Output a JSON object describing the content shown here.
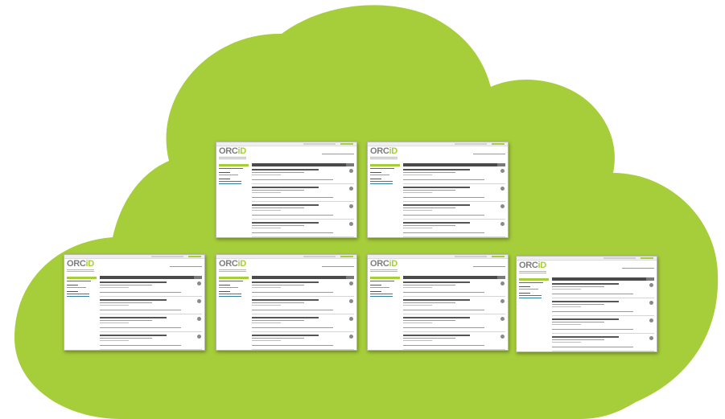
{
  "background": {
    "cloud_color": "#a6cd3a",
    "page_color": "#ffffff"
  },
  "cards": [
    {
      "logo_main": "ORC",
      "logo_accent": "iD",
      "nav": [
        "",
        "",
        "",
        ""
      ],
      "name": ""
    },
    {
      "logo_main": "ORC",
      "logo_accent": "iD",
      "nav": [
        "",
        "",
        "",
        ""
      ],
      "name": ""
    },
    {
      "logo_main": "ORC",
      "logo_accent": "iD",
      "nav": [
        "",
        "",
        "",
        ""
      ],
      "name": ""
    },
    {
      "logo_main": "ORC",
      "logo_accent": "iD",
      "nav": [
        "",
        "",
        "",
        ""
      ],
      "name": ""
    },
    {
      "logo_main": "ORC",
      "logo_accent": "iD",
      "nav": [
        "",
        "",
        "",
        ""
      ],
      "name": ""
    },
    {
      "logo_main": "ORC",
      "logo_accent": "iD",
      "nav": [
        "",
        "",
        "",
        ""
      ],
      "name": ""
    }
  ],
  "colors": {
    "orcid_green": "#a6ce39",
    "orcid_gray": "#7d7d7d",
    "nav_blue": "#338caf",
    "header_dark": "#4a4a4a"
  }
}
